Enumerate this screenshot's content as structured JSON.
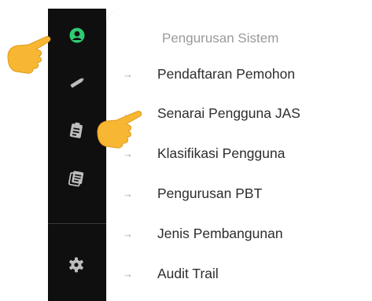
{
  "sidebar": {
    "icons": [
      {
        "name": "user-circle-icon",
        "color": "#2ecc71",
        "active": true
      },
      {
        "name": "pencil-icon"
      },
      {
        "name": "clipboard-icon"
      },
      {
        "name": "documents-icon"
      },
      {
        "name": "gear-icon"
      }
    ],
    "background": "#0f0f10"
  },
  "panel": {
    "title": "Pengurusan Sistem",
    "arrow": "→",
    "items": [
      {
        "label": "Pendaftaran Pemohon"
      },
      {
        "label": "Senarai Pengguna JAS"
      },
      {
        "label": "Klasifikasi Pengguna"
      },
      {
        "label": "Pengurusan PBT"
      },
      {
        "label": "Jenis Pembangunan"
      },
      {
        "label": "Audit Trail"
      }
    ]
  },
  "annotations": {
    "pointer_icon": "pointing-hand-icon",
    "pointer_color": "#f7b733"
  }
}
